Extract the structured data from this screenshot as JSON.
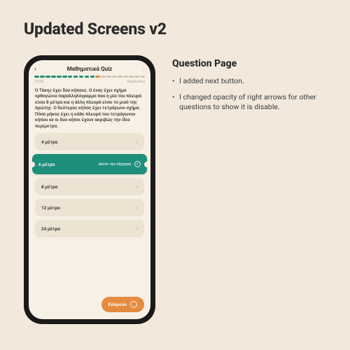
{
  "page_title": "Updated Screens v2",
  "notes": {
    "title": "Question Page",
    "items": [
      "I added next button.",
      "I changed opacity of right arrows for other questions to show it is disable."
    ]
  },
  "phone": {
    "quiz_title": "Μαθηματικά Quiz",
    "progress_counter": "12/20",
    "skip_label": "παραλείπω",
    "question": "Ο Τάκης έχει δύο κήπους. Ο ένας έχει σχήμα ορθογώνιο παραλληλόγραμμο που η μία του πλευρά είναι 8 μέτρα και η άλλη πλευρά είναι το μισό της πρώτης. Ο δεύτερος κήπος έχει τετράγωνο σχήμα. Πόσο μήκος έχει η κάθε πλευρά του τετράγωνου κήπου αν οι δυο κήποι έχουν ακριβώς την ίδια περίμετρο;",
    "answers": {
      "a1": "4 μέτρα",
      "a2": "6 μέτρα",
      "a3": "8 μέτρα",
      "a4": "12 μέτρα",
      "a5": "24 μέτρα"
    },
    "explain_label": "Δείτε την εξήγηση",
    "next_label": "Επόμενο"
  }
}
